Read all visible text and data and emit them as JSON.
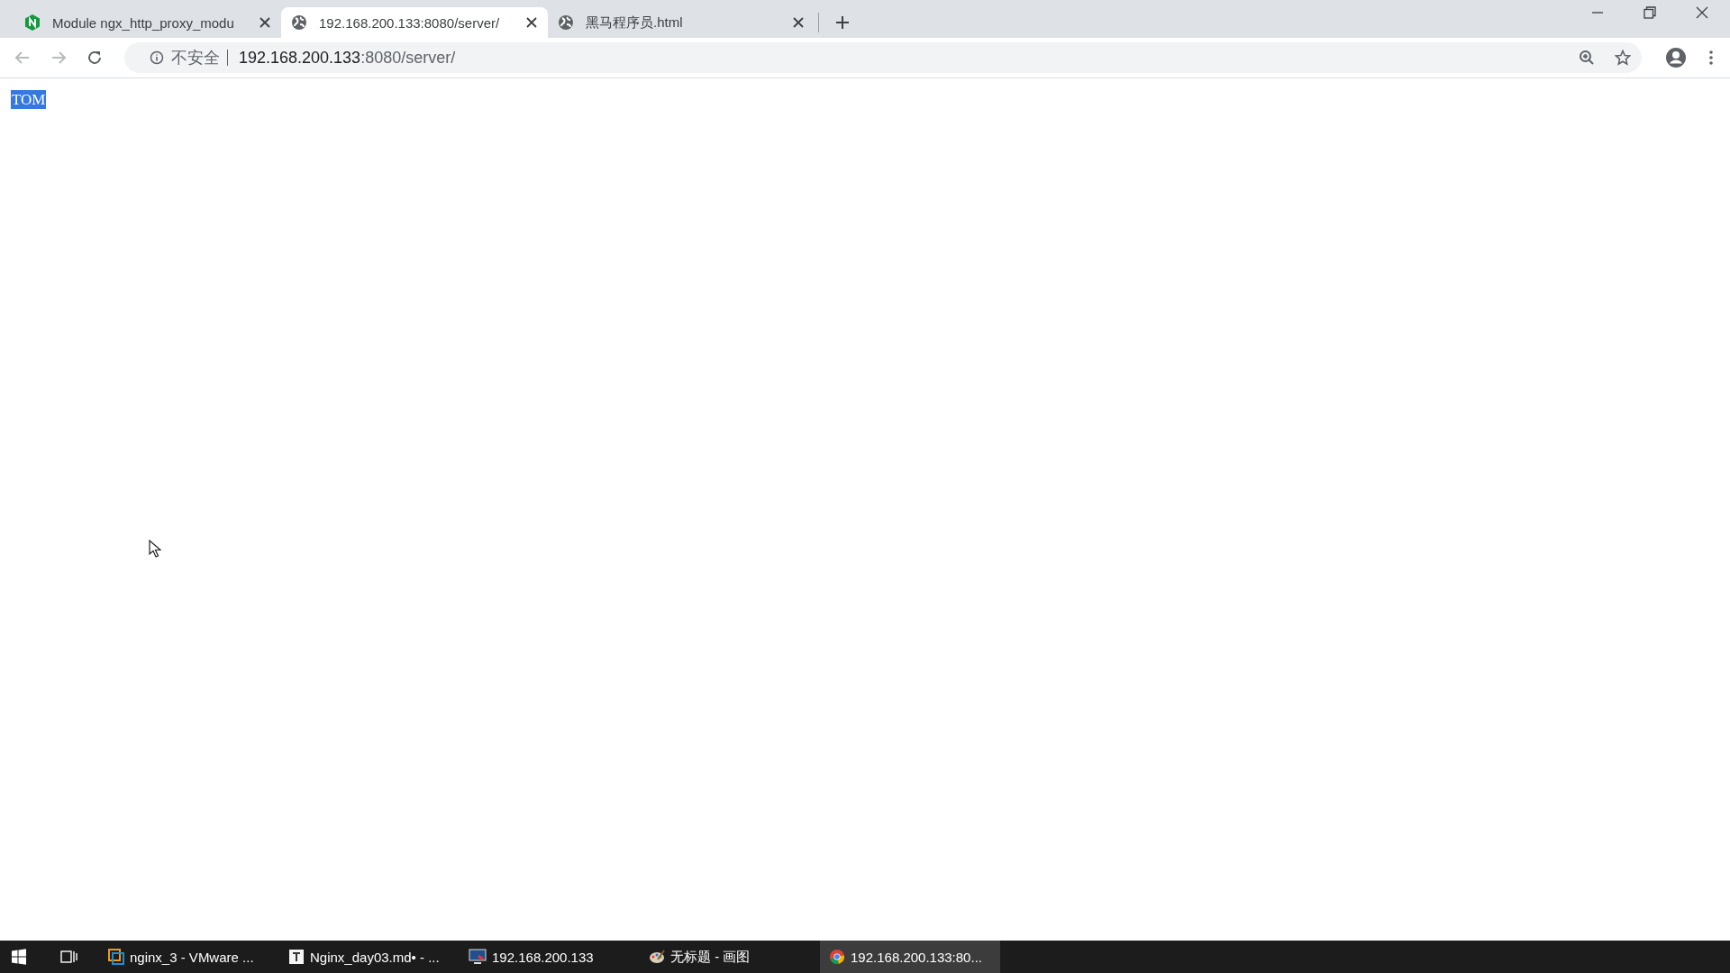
{
  "tabs": [
    {
      "title": "Module ngx_http_proxy_modu",
      "kind": "nginx",
      "selected": false
    },
    {
      "title": "192.168.200.133:8080/server/",
      "kind": "globe",
      "selected": true
    },
    {
      "title": "黑马程序员.html",
      "kind": "globe",
      "selected": false
    }
  ],
  "address_bar": {
    "security": "不安全",
    "host": "192.168.200.133",
    "rest": ":8080/server/"
  },
  "page": {
    "text": "TOM",
    "selected": true
  },
  "taskbar": {
    "items": [
      {
        "label": "nginx_3 - VMware ...",
        "kind": "vmware",
        "selected": false
      },
      {
        "label": "Nginx_day03.md• - ...",
        "kind": "typora",
        "selected": false
      },
      {
        "label": "192.168.200.133",
        "kind": "remote",
        "selected": false
      },
      {
        "label": "无标题 - 画图",
        "kind": "paint",
        "selected": false
      },
      {
        "label": "192.168.200.133:80...",
        "kind": "chrome",
        "selected": true
      }
    ]
  }
}
